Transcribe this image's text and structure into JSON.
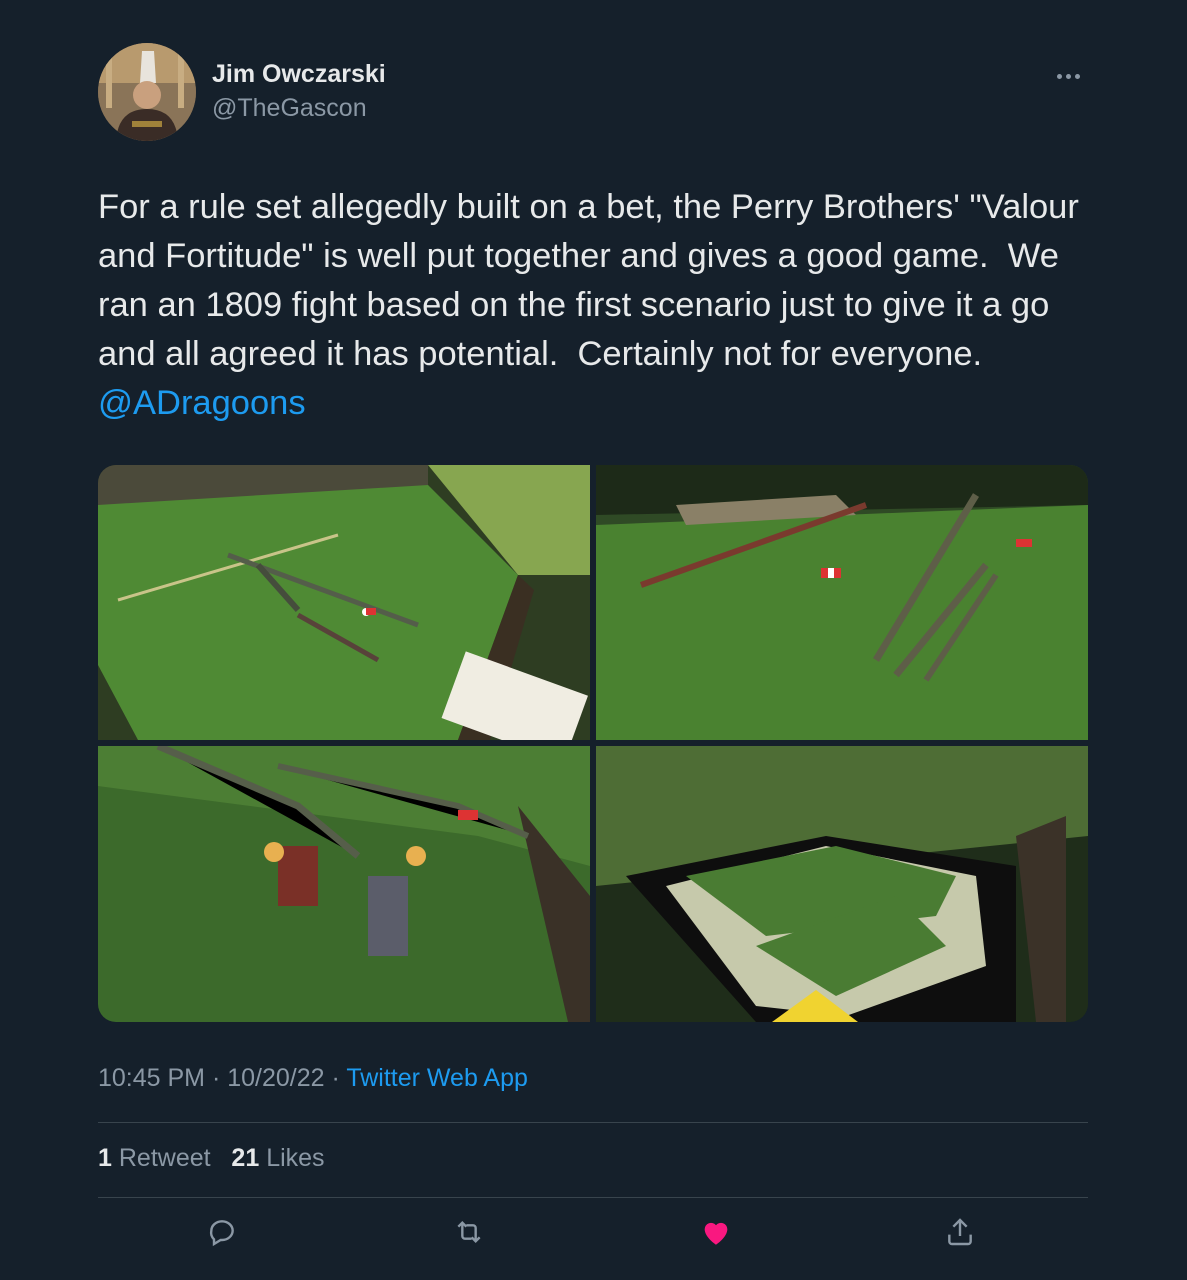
{
  "author": {
    "name": "Jim Owczarski",
    "handle": "@TheGascon"
  },
  "tweet": {
    "text": "For a rule set allegedly built on a bet, the Perry Brothers' \"Valour and Fortitude\" is well put together and gives a good game.  We ran an 1809 fight based on the first scenario just to give it a go and all agreed it has potential.  Certainly not for everyone.  ",
    "mention": "@ADragoons",
    "time": "10:45 PM",
    "separator": " · ",
    "date": "10/20/22",
    "source": "Twitter Web App"
  },
  "stats": {
    "retweets_count": "1",
    "retweets_label": "Retweet",
    "likes_count": "21",
    "likes_label": "Likes"
  },
  "colors": {
    "background": "#15202b",
    "accent": "#1d9bf0",
    "like": "#f91880",
    "muted": "#8b98a5"
  },
  "icons": [
    "more-icon",
    "reply-icon",
    "retweet-icon",
    "like-icon",
    "share-icon"
  ]
}
